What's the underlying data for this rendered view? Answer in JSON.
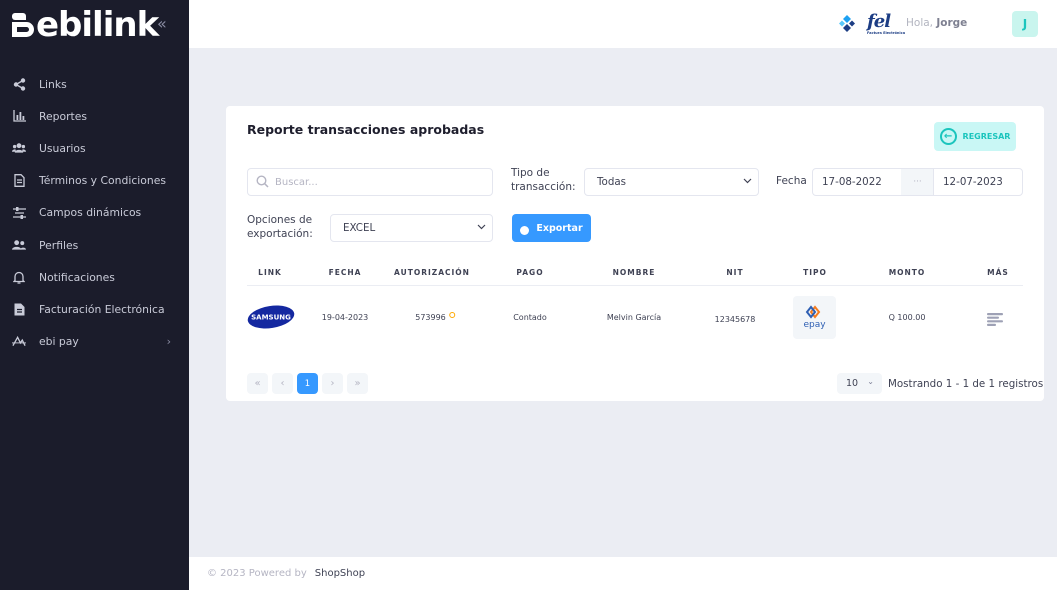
{
  "brand": {
    "logo_text": "ebilink"
  },
  "sidebar": {
    "items": [
      {
        "label": "Links",
        "icon": "share-icon"
      },
      {
        "label": "Reportes",
        "icon": "bar-chart-icon"
      },
      {
        "label": "Usuarios",
        "icon": "users-icon"
      },
      {
        "label": "Términos y Condiciones",
        "icon": "document-icon"
      },
      {
        "label": "Campos dinámicos",
        "icon": "sliders-icon"
      },
      {
        "label": "Perfiles",
        "icon": "profiles-icon"
      },
      {
        "label": "Notificaciones",
        "icon": "bell-icon"
      },
      {
        "label": "Facturación Electrónica",
        "icon": "invoice-icon"
      },
      {
        "label": "ebi pay",
        "icon": "ebi-pay-icon"
      }
    ]
  },
  "header": {
    "fel_logo": "fel",
    "fel_logo_sub": "Factura Electrónica",
    "greeting": "Hola,",
    "user_name": "Jorge",
    "avatar_initial": "J"
  },
  "report": {
    "title": "Reporte transacciones aprobadas",
    "back_label": "REGRESAR",
    "search_placeholder": "Buscar...",
    "tipo_label_1": "Tipo de",
    "tipo_label_2": "transacción:",
    "tipo_value": "Todas",
    "fecha_label": "Fecha",
    "date_from": "17-08-2022",
    "date_sep": "···",
    "date_to": "12-07-2023",
    "export_label_1": "Opciones de",
    "export_label_2": "exportación:",
    "export_value": "EXCEL",
    "export_button": "Exportar"
  },
  "table": {
    "headers": [
      "LINK",
      "FECHA",
      "AUTORIZACIÓN",
      "PAGO",
      "NOMBRE",
      "NIT",
      "TIPO",
      "MONTO",
      "MÁS"
    ],
    "rows": [
      {
        "link_logo": "SAMSUNG",
        "fecha": "19-04-2023",
        "autorizacion": "573996",
        "pago": "Contado",
        "nombre": "Melvin García",
        "nit": "12345678",
        "tipo": "epay",
        "monto": "Q 100.00"
      }
    ]
  },
  "pagination": {
    "first": "«",
    "prev": "‹",
    "current": "1",
    "next": "›",
    "last": "»",
    "page_size": "10",
    "showing": "Mostrando 1 - 1 de 1 registros"
  },
  "footer": {
    "copyright": "© 2023 Powered by",
    "link": "ShopShop"
  },
  "colors": {
    "sidebar_bg": "#1b1c2b",
    "primary": "#3699ff",
    "accent_teal": "#1bc5bd",
    "page_bg": "#ebedf3"
  }
}
